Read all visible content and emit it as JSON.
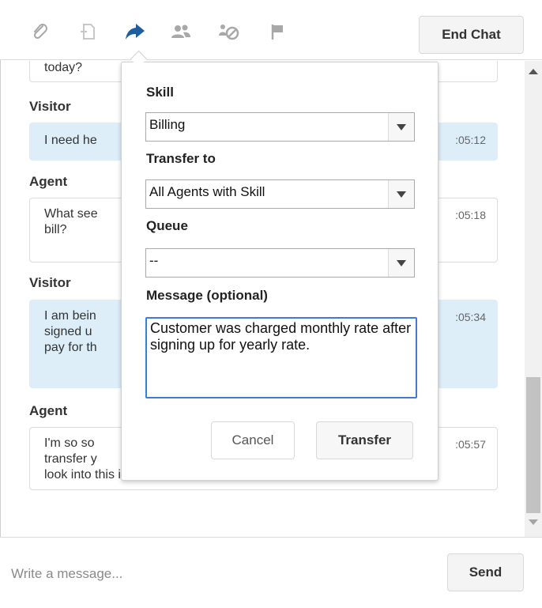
{
  "toolbar": {
    "end_chat_label": "End Chat",
    "icons": [
      "paperclip-icon",
      "file-icon",
      "transfer-arrow-icon",
      "users-icon",
      "block-user-icon",
      "flag-icon"
    ],
    "active_icon_color": "#1f5e9e",
    "inactive_icon_color": "#a8a8a8"
  },
  "transcript": {
    "partial_top_text": "today?",
    "messages": [
      {
        "sender": "Visitor",
        "text": "I need help with my bill.",
        "time": "10:05:12"
      },
      {
        "sender": "Agent",
        "text": "What seems to be the problem with your bill?",
        "time": "10:05:18"
      },
      {
        "sender": "Visitor",
        "text": "I am being charged monthly but I signed up for a yearly plan. I want to pay for the year.",
        "time": "10:05:34"
      },
      {
        "sender": "Agent",
        "text": "I'm so sorry about that. Let me transfer you to a billing agent who can look into this issue.",
        "time": "10:05:57"
      }
    ],
    "visible_texts": {
      "m1": "I need he",
      "m1_time": ":05:12",
      "m2_l1": "What see",
      "m2_l2": "bill?",
      "m2_time": ":05:18",
      "m3_l1": "I am bein",
      "m3_l2": "signed u",
      "m3_l3": "pay for th",
      "m3_time": ":05:34",
      "m4_l1": "I'm so so",
      "m4_l2": "transfer y",
      "m4_l3": "look into this issue.",
      "m4_time": ":05:57"
    },
    "visitor_bubble_color": "#ddeef9"
  },
  "transfer_popover": {
    "skill_label": "Skill",
    "skill_value": "Billing",
    "transfer_to_label": "Transfer to",
    "transfer_to_value": "All Agents with Skill",
    "queue_label": "Queue",
    "queue_value": "--",
    "message_label": "Message (optional)",
    "message_value": "Customer was charged monthly rate after signing up for yearly rate.",
    "cancel_label": "Cancel",
    "transfer_label": "Transfer"
  },
  "composer": {
    "placeholder": "Write a message...",
    "send_label": "Send"
  }
}
